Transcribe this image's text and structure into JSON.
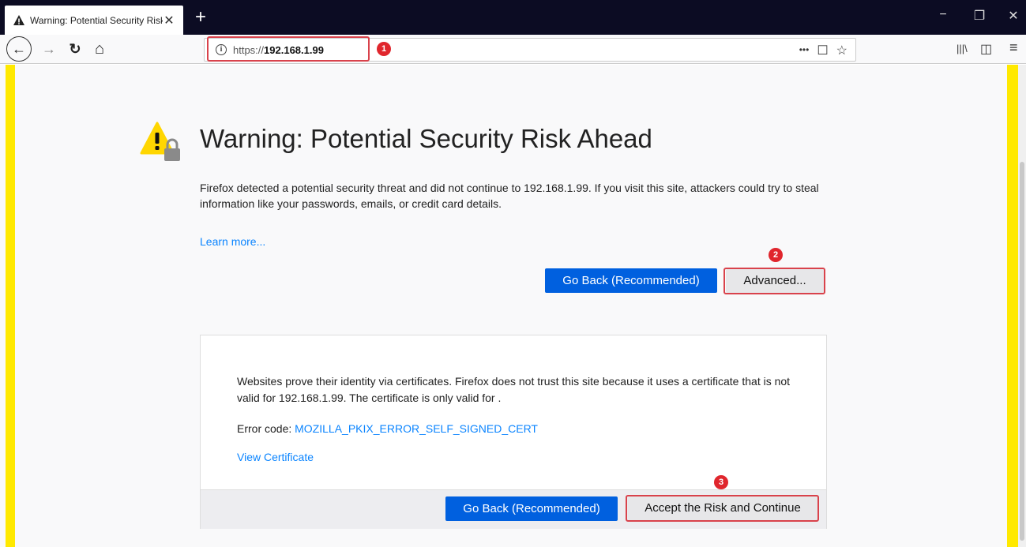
{
  "tab": {
    "title": "Warning: Potential Security Risk",
    "close": "✕",
    "new_tab": "+"
  },
  "window_controls": {
    "minimize": "−",
    "restore": "❐",
    "close": "✕"
  },
  "toolbar": {
    "back": "←",
    "forward": "→",
    "reload": "↻",
    "home": "⌂",
    "url_scheme": "https://",
    "url_host": "192.168.1.99",
    "page_actions": "•••",
    "pocket": "☐",
    "bookmark": "☆",
    "library": "|||\\",
    "sidebar": "◫",
    "menu": "≡"
  },
  "badges": {
    "one": "1",
    "two": "2",
    "three": "3"
  },
  "page": {
    "title": "Warning: Potential Security Risk Ahead",
    "description": "Firefox detected a potential security threat and did not continue to 192.168.1.99. If you visit this site, attackers could try to steal information like your passwords, emails, or credit card details.",
    "learn_more": "Learn more...",
    "go_back": "Go Back (Recommended)",
    "advanced": "Advanced..."
  },
  "advanced_panel": {
    "text": "Websites prove their identity via certificates. Firefox does not trust this site because it uses a certificate that is not valid for 192.168.1.99. The certificate is only valid for .",
    "error_label": "Error code: ",
    "error_code": "MOZILLA_PKIX_ERROR_SELF_SIGNED_CERT",
    "view_certificate": "View Certificate",
    "go_back": "Go Back (Recommended)",
    "accept": "Accept the Risk and Continue"
  },
  "colors": {
    "primary_button": "#0060df",
    "link": "#0a84ff",
    "highlight": "#d9424b",
    "badge": "#e0262d",
    "yellow_border": "#ffe900"
  }
}
